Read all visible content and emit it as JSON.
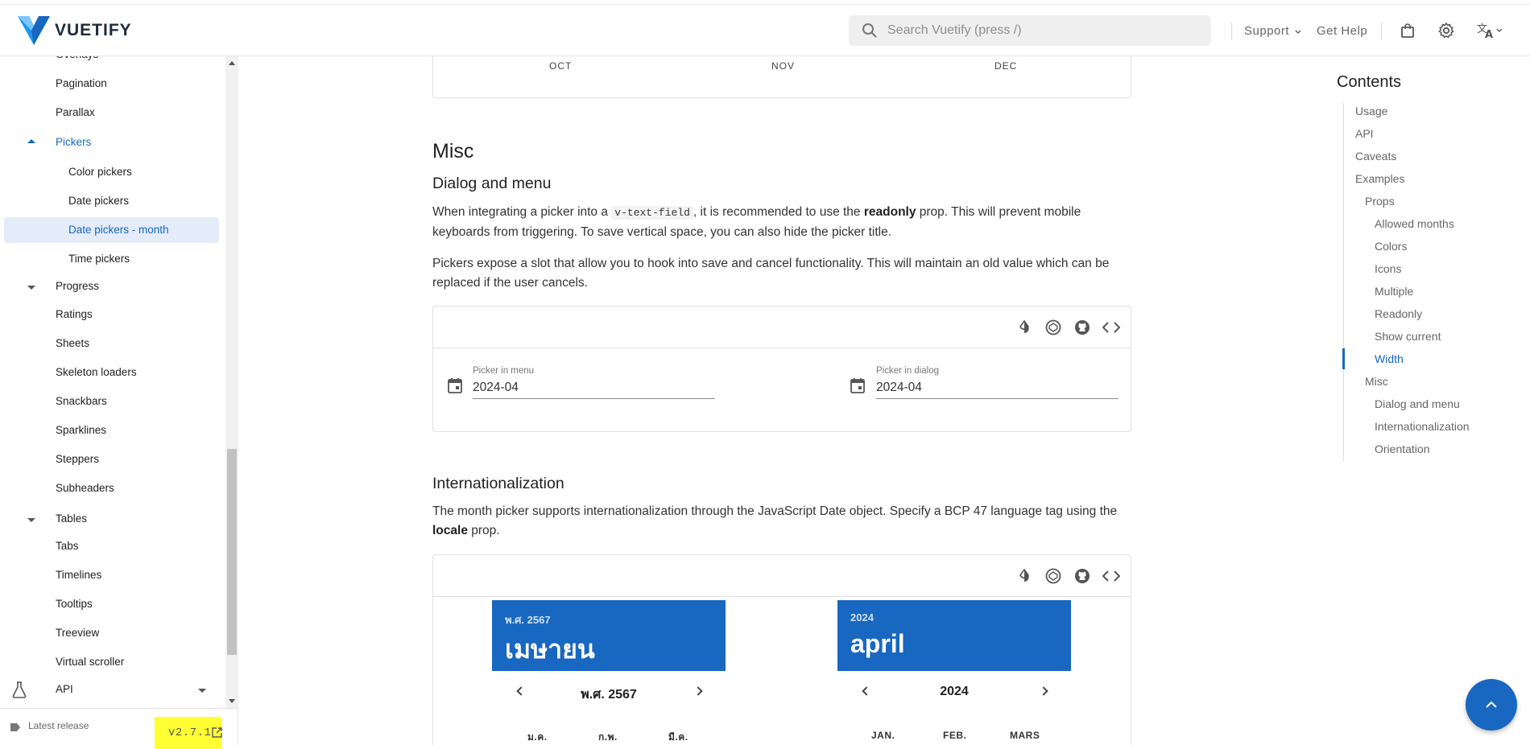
{
  "appbar": {
    "logo_text": "VUETIFY",
    "search_placeholder": "Search Vuetify (press /)",
    "support_label": "Support",
    "get_help_label": "Get Help"
  },
  "sidebar": {
    "items": [
      {
        "label": "Overlays"
      },
      {
        "label": "Pagination"
      },
      {
        "label": "Parallax"
      },
      {
        "label": "Pickers"
      },
      {
        "label": "Color pickers"
      },
      {
        "label": "Date pickers"
      },
      {
        "label": "Date pickers - month"
      },
      {
        "label": "Time pickers"
      },
      {
        "label": "Progress"
      },
      {
        "label": "Ratings"
      },
      {
        "label": "Sheets"
      },
      {
        "label": "Skeleton loaders"
      },
      {
        "label": "Snackbars"
      },
      {
        "label": "Sparklines"
      },
      {
        "label": "Steppers"
      },
      {
        "label": "Subheaders"
      },
      {
        "label": "Tables"
      },
      {
        "label": "Tabs"
      },
      {
        "label": "Timelines"
      },
      {
        "label": "Tooltips"
      },
      {
        "label": "Treeview"
      },
      {
        "label": "Virtual scroller"
      },
      {
        "label": "API"
      }
    ],
    "footer": {
      "release_label": "Latest release",
      "version": "v2.7.1"
    }
  },
  "main": {
    "top_card_months": [
      "OCT",
      "NOV",
      "DEC"
    ],
    "misc_heading": "Misc",
    "dialog_heading": "Dialog and menu",
    "dialog_para1": {
      "before": "When integrating a picker into a ",
      "code": "v-text-field",
      "middle": ", it is recommended to use the ",
      "bold": "readonly",
      "after": " prop. This will prevent mobile keyboards from triggering. To save vertical space, you can also hide the picker title."
    },
    "dialog_para2": "Pickers expose a slot that allow you to hook into save and cancel functionality. This will maintain an old value which can be replaced if the user cancels.",
    "field_menu": {
      "label": "Picker in menu",
      "value": "2024-04"
    },
    "field_dialog": {
      "label": "Picker in dialog",
      "value": "2024-04"
    },
    "intl_heading": "Internationalization",
    "intl_para": {
      "before": "The month picker supports internationalization through the JavaScript Date object. Specify a BCP 47 language tag using the ",
      "bold": "locale",
      "after": " prop."
    },
    "picker_thai": {
      "year": "พ.ศ. 2567",
      "title": "เมษายน",
      "nav_year": "พ.ศ. 2567",
      "months": [
        "ม.ค.",
        "ก.พ.",
        "มี.ค."
      ]
    },
    "picker_en": {
      "year": "2024",
      "title": "april",
      "nav_year": "2024",
      "months": [
        "JAN.",
        "FEB.",
        "MARS"
      ]
    }
  },
  "toc": {
    "title": "Contents",
    "items": [
      {
        "label": "Usage"
      },
      {
        "label": "API"
      },
      {
        "label": "Caveats"
      },
      {
        "label": "Examples"
      },
      {
        "label": "Props"
      },
      {
        "label": "Allowed months"
      },
      {
        "label": "Colors"
      },
      {
        "label": "Icons"
      },
      {
        "label": "Multiple"
      },
      {
        "label": "Readonly"
      },
      {
        "label": "Show current"
      },
      {
        "label": "Width"
      },
      {
        "label": "Misc"
      },
      {
        "label": "Dialog and menu"
      },
      {
        "label": "Internationalization"
      },
      {
        "label": "Orientation"
      }
    ]
  },
  "colors": {
    "primary": "#1867c0",
    "highlight": "#ffff33"
  }
}
